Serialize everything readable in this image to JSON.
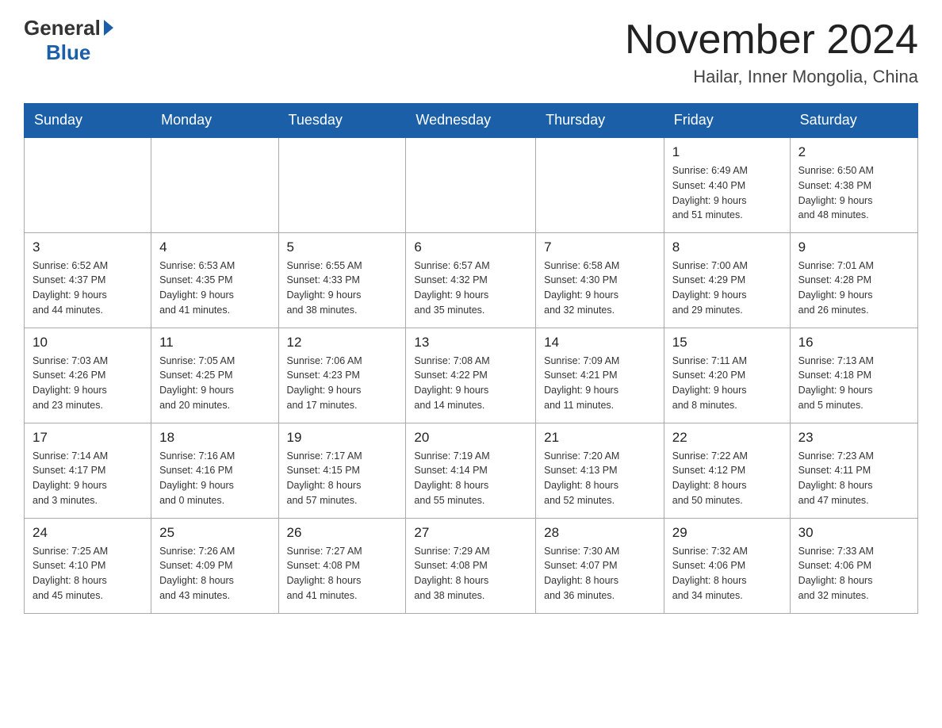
{
  "header": {
    "logo_general": "General",
    "logo_blue": "Blue",
    "title": "November 2024",
    "location": "Hailar, Inner Mongolia, China"
  },
  "weekdays": [
    "Sunday",
    "Monday",
    "Tuesday",
    "Wednesday",
    "Thursday",
    "Friday",
    "Saturday"
  ],
  "weeks": [
    [
      {
        "day": "",
        "info": ""
      },
      {
        "day": "",
        "info": ""
      },
      {
        "day": "",
        "info": ""
      },
      {
        "day": "",
        "info": ""
      },
      {
        "day": "",
        "info": ""
      },
      {
        "day": "1",
        "info": "Sunrise: 6:49 AM\nSunset: 4:40 PM\nDaylight: 9 hours\nand 51 minutes."
      },
      {
        "day": "2",
        "info": "Sunrise: 6:50 AM\nSunset: 4:38 PM\nDaylight: 9 hours\nand 48 minutes."
      }
    ],
    [
      {
        "day": "3",
        "info": "Sunrise: 6:52 AM\nSunset: 4:37 PM\nDaylight: 9 hours\nand 44 minutes."
      },
      {
        "day": "4",
        "info": "Sunrise: 6:53 AM\nSunset: 4:35 PM\nDaylight: 9 hours\nand 41 minutes."
      },
      {
        "day": "5",
        "info": "Sunrise: 6:55 AM\nSunset: 4:33 PM\nDaylight: 9 hours\nand 38 minutes."
      },
      {
        "day": "6",
        "info": "Sunrise: 6:57 AM\nSunset: 4:32 PM\nDaylight: 9 hours\nand 35 minutes."
      },
      {
        "day": "7",
        "info": "Sunrise: 6:58 AM\nSunset: 4:30 PM\nDaylight: 9 hours\nand 32 minutes."
      },
      {
        "day": "8",
        "info": "Sunrise: 7:00 AM\nSunset: 4:29 PM\nDaylight: 9 hours\nand 29 minutes."
      },
      {
        "day": "9",
        "info": "Sunrise: 7:01 AM\nSunset: 4:28 PM\nDaylight: 9 hours\nand 26 minutes."
      }
    ],
    [
      {
        "day": "10",
        "info": "Sunrise: 7:03 AM\nSunset: 4:26 PM\nDaylight: 9 hours\nand 23 minutes."
      },
      {
        "day": "11",
        "info": "Sunrise: 7:05 AM\nSunset: 4:25 PM\nDaylight: 9 hours\nand 20 minutes."
      },
      {
        "day": "12",
        "info": "Sunrise: 7:06 AM\nSunset: 4:23 PM\nDaylight: 9 hours\nand 17 minutes."
      },
      {
        "day": "13",
        "info": "Sunrise: 7:08 AM\nSunset: 4:22 PM\nDaylight: 9 hours\nand 14 minutes."
      },
      {
        "day": "14",
        "info": "Sunrise: 7:09 AM\nSunset: 4:21 PM\nDaylight: 9 hours\nand 11 minutes."
      },
      {
        "day": "15",
        "info": "Sunrise: 7:11 AM\nSunset: 4:20 PM\nDaylight: 9 hours\nand 8 minutes."
      },
      {
        "day": "16",
        "info": "Sunrise: 7:13 AM\nSunset: 4:18 PM\nDaylight: 9 hours\nand 5 minutes."
      }
    ],
    [
      {
        "day": "17",
        "info": "Sunrise: 7:14 AM\nSunset: 4:17 PM\nDaylight: 9 hours\nand 3 minutes."
      },
      {
        "day": "18",
        "info": "Sunrise: 7:16 AM\nSunset: 4:16 PM\nDaylight: 9 hours\nand 0 minutes."
      },
      {
        "day": "19",
        "info": "Sunrise: 7:17 AM\nSunset: 4:15 PM\nDaylight: 8 hours\nand 57 minutes."
      },
      {
        "day": "20",
        "info": "Sunrise: 7:19 AM\nSunset: 4:14 PM\nDaylight: 8 hours\nand 55 minutes."
      },
      {
        "day": "21",
        "info": "Sunrise: 7:20 AM\nSunset: 4:13 PM\nDaylight: 8 hours\nand 52 minutes."
      },
      {
        "day": "22",
        "info": "Sunrise: 7:22 AM\nSunset: 4:12 PM\nDaylight: 8 hours\nand 50 minutes."
      },
      {
        "day": "23",
        "info": "Sunrise: 7:23 AM\nSunset: 4:11 PM\nDaylight: 8 hours\nand 47 minutes."
      }
    ],
    [
      {
        "day": "24",
        "info": "Sunrise: 7:25 AM\nSunset: 4:10 PM\nDaylight: 8 hours\nand 45 minutes."
      },
      {
        "day": "25",
        "info": "Sunrise: 7:26 AM\nSunset: 4:09 PM\nDaylight: 8 hours\nand 43 minutes."
      },
      {
        "day": "26",
        "info": "Sunrise: 7:27 AM\nSunset: 4:08 PM\nDaylight: 8 hours\nand 41 minutes."
      },
      {
        "day": "27",
        "info": "Sunrise: 7:29 AM\nSunset: 4:08 PM\nDaylight: 8 hours\nand 38 minutes."
      },
      {
        "day": "28",
        "info": "Sunrise: 7:30 AM\nSunset: 4:07 PM\nDaylight: 8 hours\nand 36 minutes."
      },
      {
        "day": "29",
        "info": "Sunrise: 7:32 AM\nSunset: 4:06 PM\nDaylight: 8 hours\nand 34 minutes."
      },
      {
        "day": "30",
        "info": "Sunrise: 7:33 AM\nSunset: 4:06 PM\nDaylight: 8 hours\nand 32 minutes."
      }
    ]
  ]
}
